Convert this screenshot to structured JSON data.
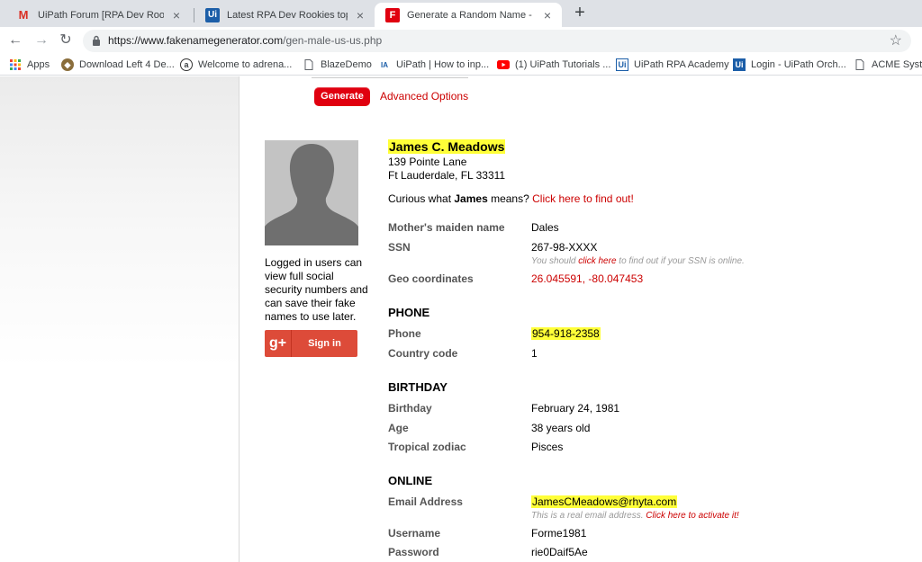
{
  "browser": {
    "tabs": [
      {
        "title": "UiPath Forum [RPA Dev Rookies]",
        "favicon": "gmail-icon"
      },
      {
        "title": "Latest RPA Dev Rookies topics - U",
        "favicon": "uipath-icon"
      },
      {
        "title": "Generate a Random Name - Male",
        "favicon": "fakename-icon"
      }
    ],
    "url_host": "https://www.fakenamegenerator.com",
    "url_path": "/gen-male-us-us.php",
    "bookmarks": [
      {
        "label": "Apps",
        "icon": "apps-grid-icon"
      },
      {
        "label": "Download Left 4 De...",
        "icon": "badge-icon"
      },
      {
        "label": "Welcome to adrena...",
        "icon": "amazon-icon"
      },
      {
        "label": "BlazeDemo",
        "icon": "page-icon"
      },
      {
        "label": "UiPath | How to inp...",
        "icon": "uipath-icon"
      },
      {
        "label": "(1) UiPath Tutorials ...",
        "icon": "youtube-icon"
      },
      {
        "label": "UiPath RPA Academy",
        "icon": "uipath-icon"
      },
      {
        "label": "Login - UiPath Orch...",
        "icon": "uipath-icon"
      },
      {
        "label": "ACME System",
        "icon": "page-icon"
      }
    ]
  },
  "page": {
    "generate_label": "Generate",
    "advanced_label": "Advanced Options",
    "login_text": "Logged in users can view full social security numbers and can save their fake names to use later.",
    "gplus_glyph": "g+",
    "signin_label": "Sign in",
    "person": {
      "name": "James C. Meadows",
      "street": "139 Pointe Lane",
      "city": "Ft Lauderdale, FL 33311",
      "curious_prefix": "Curious what ",
      "curious_name": "James",
      "curious_mid": " means? ",
      "curious_link": "Click here to find out!"
    },
    "fields": {
      "maiden_label": "Mother's maiden name",
      "maiden_value": "Dales",
      "ssn_label": "SSN",
      "ssn_value": "267-98-XXXX",
      "ssn_note_prefix": "You should ",
      "ssn_note_link": "click here",
      "ssn_note_suffix": " to find out if your SSN is online.",
      "geo_label": "Geo coordinates",
      "geo_value": "26.045591, -80.047453",
      "phone_section": "PHONE",
      "phone_label": "Phone",
      "phone_value": "954-918-2358",
      "country_label": "Country code",
      "country_value": "1",
      "birthday_section": "BIRTHDAY",
      "birthday_label": "Birthday",
      "birthday_value": "February 24, 1981",
      "age_label": "Age",
      "age_value": "38 years old",
      "zodiac_label": "Tropical zodiac",
      "zodiac_value": "Pisces",
      "online_section": "ONLINE",
      "email_label": "Email Address",
      "email_value": "JamesCMeadows@rhyta.com",
      "email_note_prefix": "This is a real email address. ",
      "email_note_link": "Click here to activate it!",
      "username_label": "Username",
      "username_value": "Forme1981",
      "password_label": "Password",
      "password_value": "rie0Daif5Ae"
    }
  }
}
